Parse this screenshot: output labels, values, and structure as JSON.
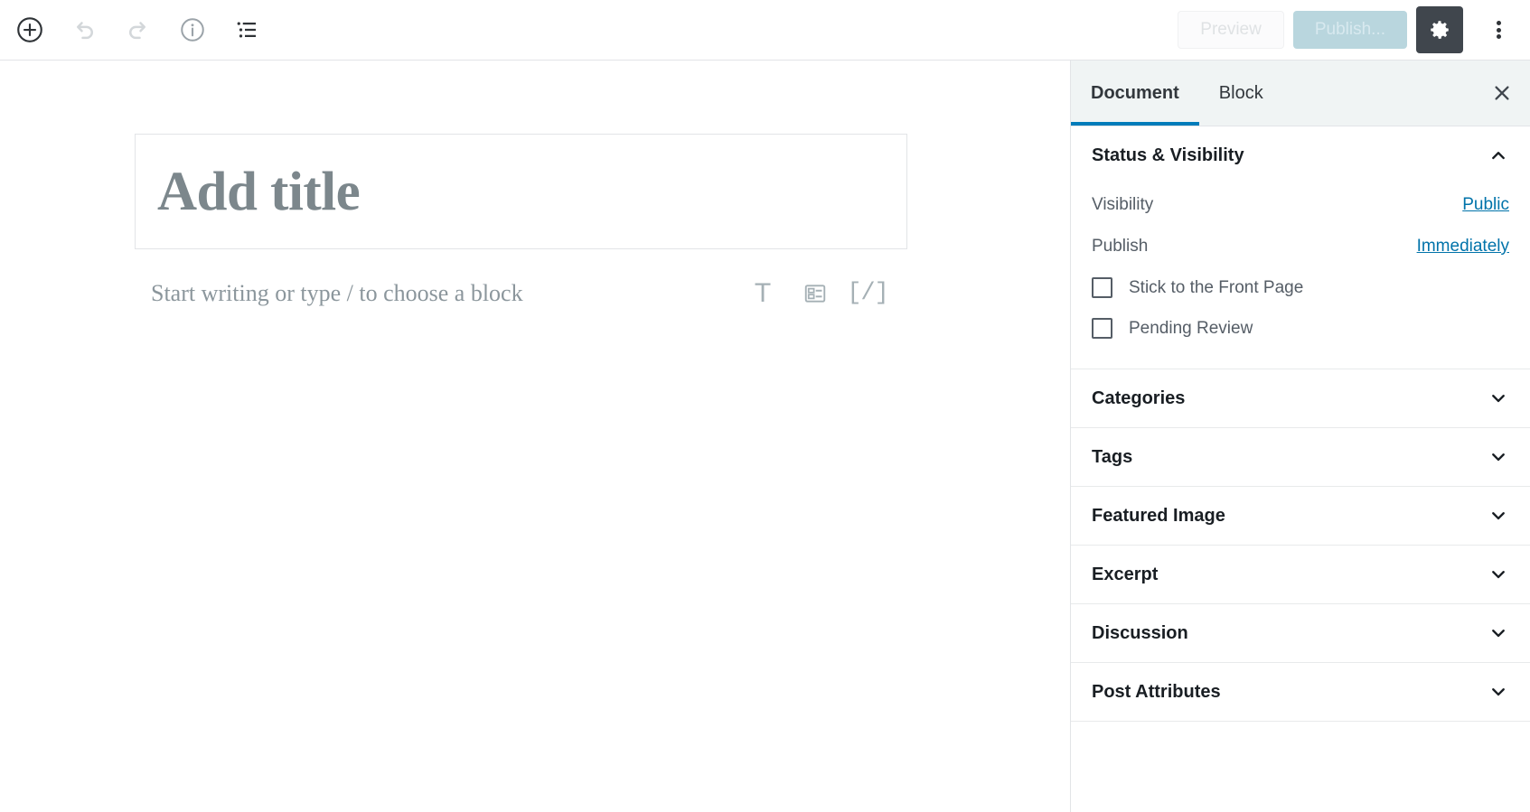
{
  "toolbar": {
    "left_buttons": [
      {
        "name": "add-block-button",
        "icon": "plus-circle-icon",
        "label": "Add block",
        "disabled": false
      },
      {
        "name": "undo-button",
        "icon": "undo-icon",
        "label": "Undo",
        "disabled": true
      },
      {
        "name": "redo-button",
        "icon": "redo-icon",
        "label": "Redo",
        "disabled": true
      },
      {
        "name": "content-structure-button",
        "icon": "info-icon",
        "label": "Content structure",
        "disabled": false
      },
      {
        "name": "block-navigation-button",
        "icon": "list-view-icon",
        "label": "Block navigation",
        "disabled": false
      }
    ],
    "preview_label": "Preview",
    "publish_label": "Publish...",
    "settings_icon": "gear-icon",
    "more_menu_icon": "vertical-dots-icon"
  },
  "editor": {
    "title_placeholder": "Add title",
    "paragraph_placeholder": "Start writing or type / to choose a block",
    "quick_blocks": [
      {
        "name": "paragraph-block-button",
        "icon": "text-icon",
        "glyph": "T"
      },
      {
        "name": "image-block-button",
        "icon": "image-icon",
        "glyph": ""
      },
      {
        "name": "code-block-button",
        "icon": "code-icon",
        "glyph": "[/]"
      }
    ]
  },
  "sidebar": {
    "tabs": [
      {
        "label": "Document",
        "active": true
      },
      {
        "label": "Block",
        "active": false
      }
    ],
    "close_icon": "close-icon",
    "status_section": {
      "title": "Status & Visibility",
      "chevron": "chevron-up-icon",
      "expanded": true,
      "rows": [
        {
          "label": "Visibility",
          "value": "Public"
        },
        {
          "label": "Publish",
          "value": "Immediately"
        }
      ],
      "checkboxes": [
        {
          "label": "Stick to the Front Page",
          "checked": false
        },
        {
          "label": "Pending Review",
          "checked": false
        }
      ]
    },
    "sections": [
      {
        "title": "Categories",
        "chevron": "chevron-down-icon"
      },
      {
        "title": "Tags",
        "chevron": "chevron-down-icon"
      },
      {
        "title": "Featured Image",
        "chevron": "chevron-down-icon"
      },
      {
        "title": "Excerpt",
        "chevron": "chevron-down-icon"
      },
      {
        "title": "Discussion",
        "chevron": "chevron-down-icon"
      },
      {
        "title": "Post Attributes",
        "chevron": "chevron-down-icon"
      }
    ]
  },
  "colors": {
    "accent": "#007cba",
    "link": "#0073aa",
    "publish_button_bg": "#b9d6de",
    "gear_button_bg": "#40464d"
  }
}
